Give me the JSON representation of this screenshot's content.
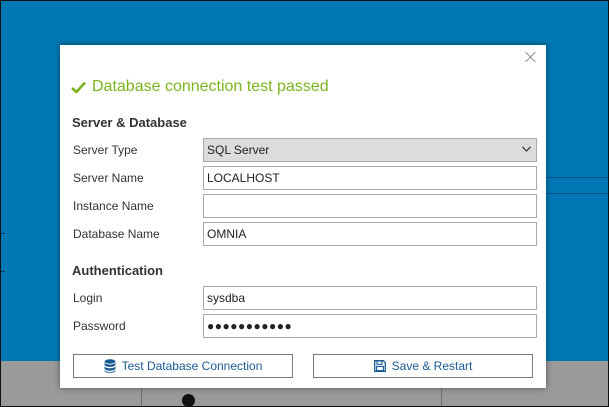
{
  "dialog": {
    "close_label": "×",
    "status_text": "Database connection test passed",
    "status_color": "#7ab51d"
  },
  "server_section": {
    "title": "Server & Database",
    "server_type_label": "Server Type",
    "server_type_value": "SQL Server",
    "server_name_label": "Server Name",
    "server_name_value": "LOCALHOST",
    "instance_name_label": "Instance Name",
    "instance_name_value": "",
    "database_name_label": "Database Name",
    "database_name_value": "OMNIA"
  },
  "auth_section": {
    "title": "Authentication",
    "login_label": "Login",
    "login_value": "sysdba",
    "password_label": "Password",
    "password_value": "●●●●●●●●●●●"
  },
  "buttons": {
    "test_label": "Test Database Connection",
    "save_label": "Save & Restart"
  },
  "colors": {
    "backdrop": "#0078b4",
    "accent_text": "#1a5a94"
  },
  "icons": {
    "status": "check-icon",
    "close": "close-icon",
    "dropdown": "chevron-down-icon",
    "test_button": "database-icon",
    "save_button": "floppy-disk-icon"
  }
}
